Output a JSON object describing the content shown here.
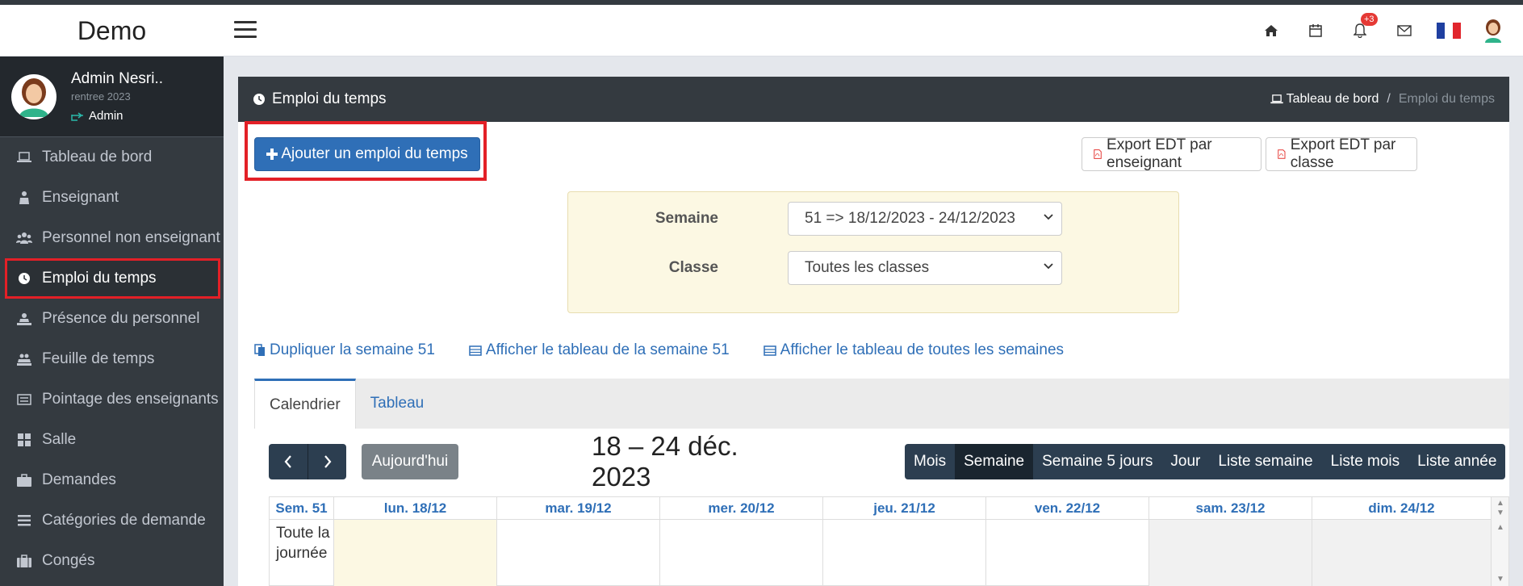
{
  "app": {
    "brand": "Demo"
  },
  "topbar": {
    "icons": [
      "home-icon",
      "calendar-icon",
      "bell-icon",
      "envelope-icon",
      "flag-fr-icon",
      "user-avatar-icon"
    ],
    "notification_badge": "+3"
  },
  "user": {
    "name": "Admin Nesri..",
    "subtitle": "rentree 2023",
    "role": "Admin"
  },
  "sidebar": {
    "items": [
      {
        "label": "Tableau de bord",
        "icon": "laptop-icon"
      },
      {
        "label": "Enseignant",
        "icon": "teacher-icon"
      },
      {
        "label": "Personnel non enseignant",
        "icon": "users-icon"
      },
      {
        "label": "Emploi du temps",
        "icon": "clock-icon",
        "active": true
      },
      {
        "label": "Présence du personnel",
        "icon": "presence-icon"
      },
      {
        "label": "Feuille de temps",
        "icon": "timesheet-icon"
      },
      {
        "label": "Pointage des enseignants",
        "icon": "list-icon"
      },
      {
        "label": "Salle",
        "icon": "grid-icon"
      },
      {
        "label": "Demandes",
        "icon": "briefcase-icon"
      },
      {
        "label": "Catégories de demande",
        "icon": "bars-icon"
      },
      {
        "label": "Congés",
        "icon": "suitcase-icon"
      }
    ]
  },
  "page": {
    "title": "Emploi du temps",
    "breadcrumb": {
      "home": "Tableau de bord",
      "separator": "/",
      "current": "Emploi du temps"
    }
  },
  "actions": {
    "add": "Ajouter un emploi du temps",
    "export_teacher": "Export EDT par enseignant",
    "export_class": "Export EDT par classe"
  },
  "filters": {
    "week_label": "Semaine",
    "week_value": "51  => 18/12/2023 - 24/12/2023",
    "class_label": "Classe",
    "class_value": "Toutes les classes"
  },
  "links": {
    "duplicate": "Dupliquer la semaine 51",
    "show_week": "Afficher le tableau de la semaine 51",
    "show_all": "Afficher le tableau de toutes les semaines"
  },
  "tabs": [
    {
      "label": "Calendrier",
      "active": true
    },
    {
      "label": "Tableau"
    }
  ],
  "calendar": {
    "today": "Aujourd'hui",
    "title": "18 – 24 déc. 2023",
    "views": [
      {
        "label": "Mois"
      },
      {
        "label": "Semaine",
        "active": true
      },
      {
        "label": "Semaine 5 jours"
      },
      {
        "label": "Jour"
      },
      {
        "label": "Liste semaine"
      },
      {
        "label": "Liste mois"
      },
      {
        "label": "Liste année"
      }
    ],
    "week_col": "Sem. 51",
    "days": [
      "lun. 18/12",
      "mar. 19/12",
      "mer. 20/12",
      "jeu. 21/12",
      "ven. 22/12",
      "sam. 23/12",
      "dim. 24/12"
    ],
    "allday": "Toute la journée"
  },
  "colors": {
    "primary": "#2f6fb7",
    "dark": "#343a40",
    "highlight": "#e32027",
    "today": "#fcf8e3"
  }
}
